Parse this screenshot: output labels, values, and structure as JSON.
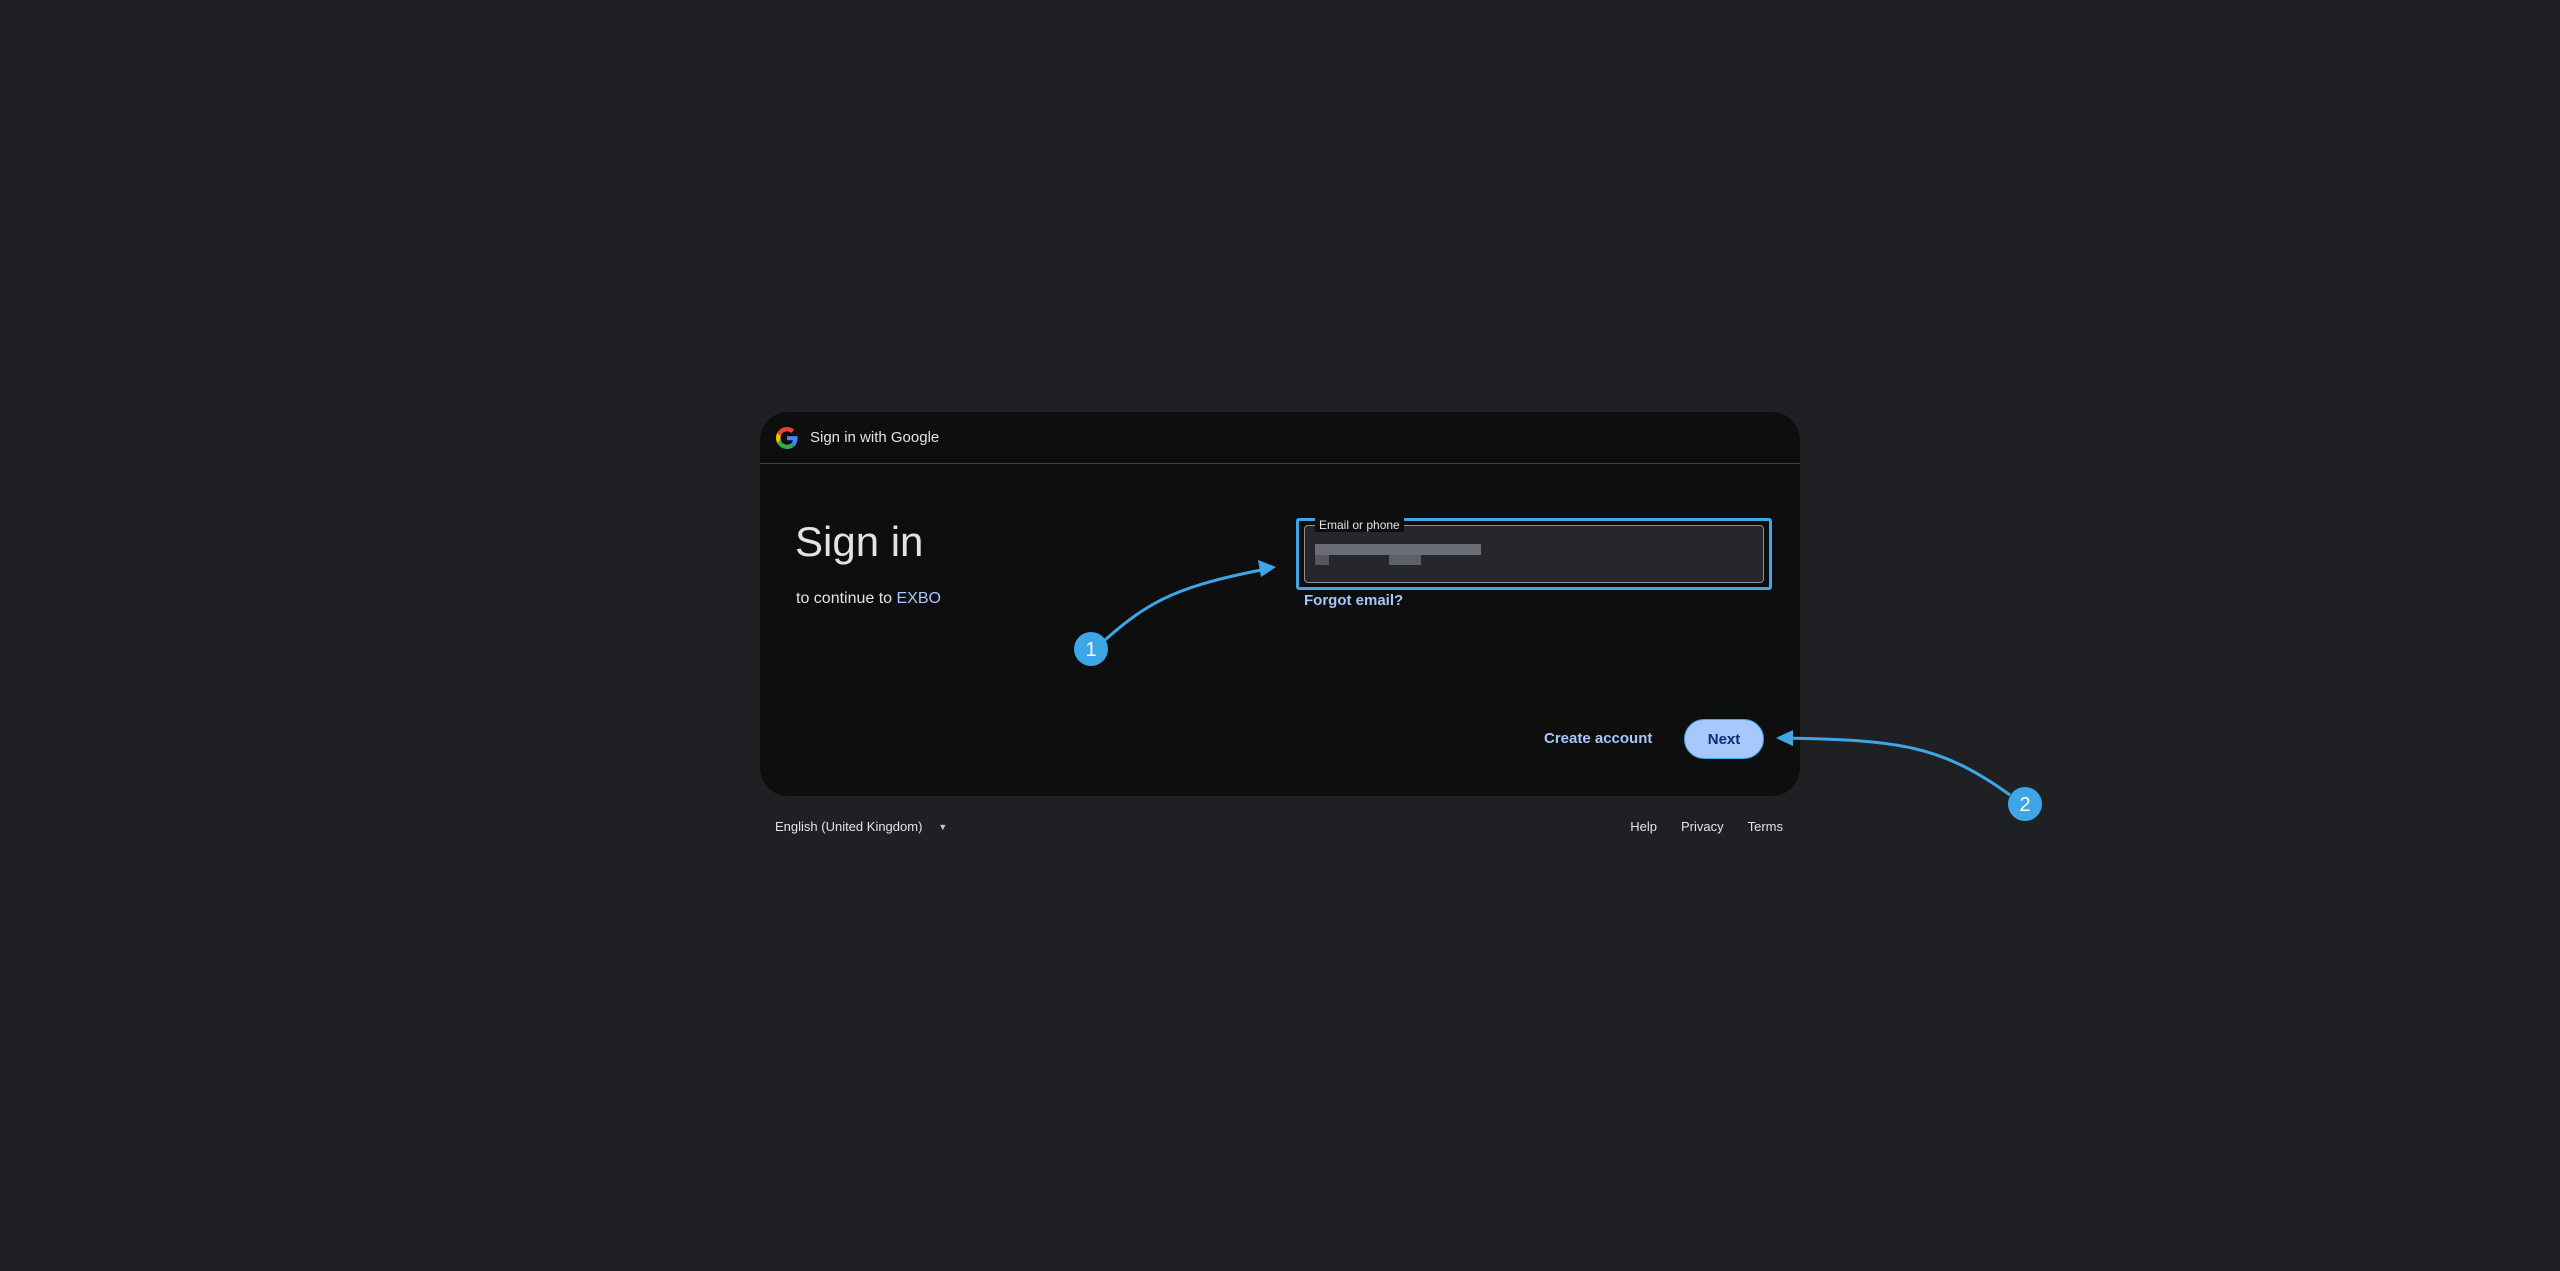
{
  "header": {
    "title": "Sign in with Google",
    "logo_icon": "google-g-icon"
  },
  "main": {
    "heading": "Sign in",
    "subtitle_prefix": "to continue to ",
    "app_name": "EXBO"
  },
  "email_field": {
    "label": "Email or phone",
    "value": ""
  },
  "links": {
    "forgot_email": "Forgot email?"
  },
  "actions": {
    "create_account": "Create account",
    "next": "Next"
  },
  "footer": {
    "language": "English (United Kingdom)",
    "help": "Help",
    "privacy": "Privacy",
    "terms": "Terms"
  },
  "annotations": {
    "step1": "1",
    "step2": "2"
  },
  "colors": {
    "background": "#1f2023",
    "card": "#0e0e0e",
    "link": "#a8c7fa",
    "primary_button": "#a8c7fa",
    "annotation": "#3ea6e6"
  }
}
